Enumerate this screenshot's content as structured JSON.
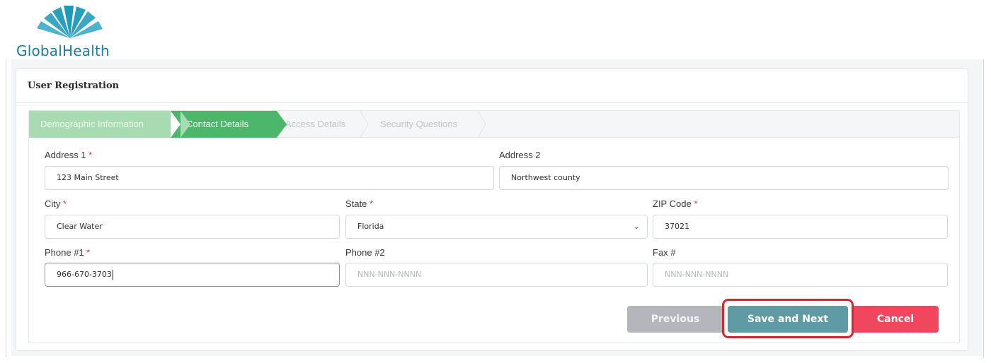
{
  "brand": {
    "name": "GlobalHealth",
    "logo_color": "#1a7fa0"
  },
  "card": {
    "title": "User Registration"
  },
  "steps": [
    {
      "label": "Demographic Information",
      "state": "completed"
    },
    {
      "label": "Contact Details",
      "state": "active"
    },
    {
      "label": "Access Details",
      "state": "pending"
    },
    {
      "label": "Security Questions",
      "state": "pending"
    }
  ],
  "form": {
    "address1": {
      "label": "Address 1",
      "required": "*",
      "value": "123 Main Street"
    },
    "address2": {
      "label": "Address 2",
      "value": "Northwest county"
    },
    "city": {
      "label": "City",
      "required": "*",
      "value": "Clear Water"
    },
    "state": {
      "label": "State",
      "required": "*",
      "value": "Florida"
    },
    "zip": {
      "label": "ZIP Code",
      "required": "*",
      "value": "37021"
    },
    "phone1": {
      "label": "Phone #1",
      "required": "*",
      "value": "966-670-3703"
    },
    "phone2": {
      "label": "Phone #2",
      "placeholder": "NNN-NNN-NNNN"
    },
    "fax": {
      "label": "Fax #",
      "placeholder": "NNN-NNN-NNNN"
    }
  },
  "buttons": {
    "previous": "Previous",
    "save_next": "Save and Next",
    "cancel": "Cancel"
  },
  "colors": {
    "active_step": "#4cb66a",
    "completed_step": "#a8dbb1",
    "save": "#5f9ba5",
    "cancel": "#f0465e",
    "highlight": "#d7262e"
  }
}
